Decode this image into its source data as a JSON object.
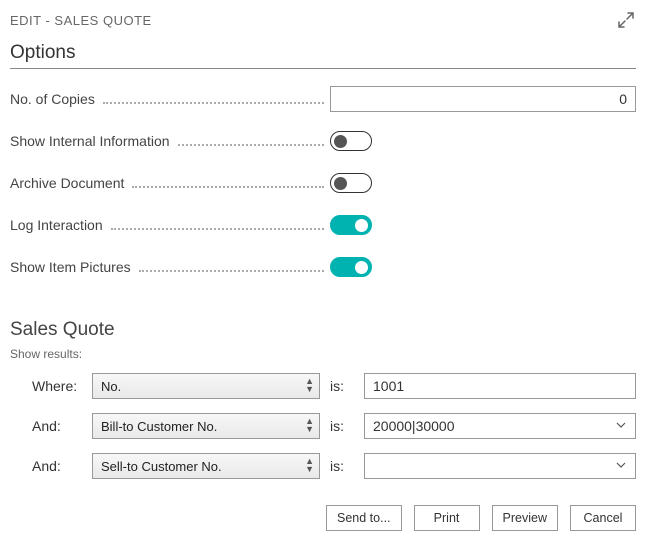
{
  "header": {
    "title": "EDIT - SALES QUOTE"
  },
  "options": {
    "section_title": "Options",
    "copies_label": "No. of Copies",
    "copies_value": "0",
    "internal_label": "Show Internal Information",
    "internal_on": false,
    "archive_label": "Archive Document",
    "archive_on": false,
    "log_label": "Log Interaction",
    "log_on": true,
    "pictures_label": "Show Item Pictures",
    "pictures_on": true
  },
  "sales_quote": {
    "title": "Sales Quote",
    "show_results": "Show results:",
    "where_label": "Where:",
    "and_label": "And:",
    "is_label": "is:",
    "filters": [
      {
        "field": "No.",
        "value": "1001",
        "has_dropdown": false
      },
      {
        "field": "Bill-to Customer No.",
        "value": "20000|30000",
        "has_dropdown": true
      },
      {
        "field": "Sell-to Customer No.",
        "value": "",
        "has_dropdown": true
      }
    ]
  },
  "buttons": {
    "send": "Send to...",
    "print": "Print",
    "preview": "Preview",
    "cancel": "Cancel"
  }
}
